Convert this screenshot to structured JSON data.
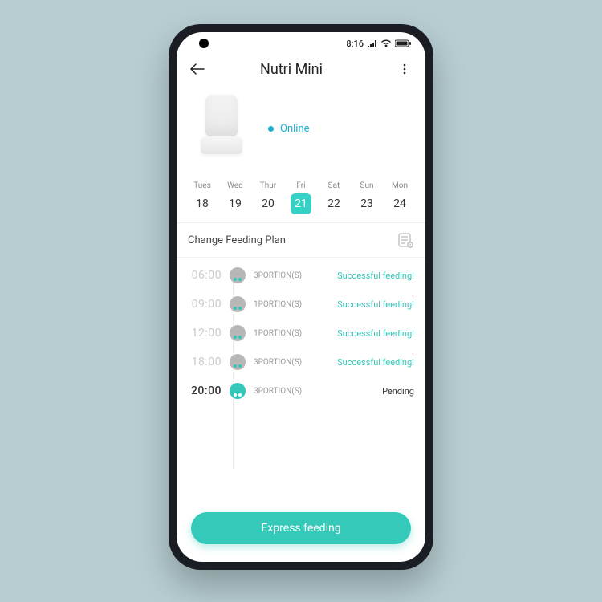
{
  "statusbar": {
    "time": "8:16"
  },
  "header": {
    "title": "Nutri Mini"
  },
  "device": {
    "status_label": "Online"
  },
  "week": {
    "days": [
      {
        "name": "Tues",
        "num": "18"
      },
      {
        "name": "Wed",
        "num": "19"
      },
      {
        "name": "Thur",
        "num": "20"
      },
      {
        "name": "Fri",
        "num": "21",
        "selected": true
      },
      {
        "name": "Sat",
        "num": "22"
      },
      {
        "name": "Sun",
        "num": "23"
      },
      {
        "name": "Mon",
        "num": "24"
      }
    ]
  },
  "section": {
    "title": "Change Feeding Plan"
  },
  "feedings": [
    {
      "time": "06:00",
      "portions": "3PORTION(S)",
      "status": "Successful feeding!",
      "state": "done"
    },
    {
      "time": "09:00",
      "portions": "1PORTION(S)",
      "status": "Successful feeding!",
      "state": "done"
    },
    {
      "time": "12:00",
      "portions": "1PORTION(S)",
      "status": "Successful feeding!",
      "state": "done"
    },
    {
      "time": "18:00",
      "portions": "3PORTION(S)",
      "status": "Successful feeding!",
      "state": "done"
    },
    {
      "time": "20:00",
      "portions": "3PORTION(S)",
      "status": "Pending",
      "state": "pending"
    }
  ],
  "cta": {
    "label": "Express feeding"
  }
}
